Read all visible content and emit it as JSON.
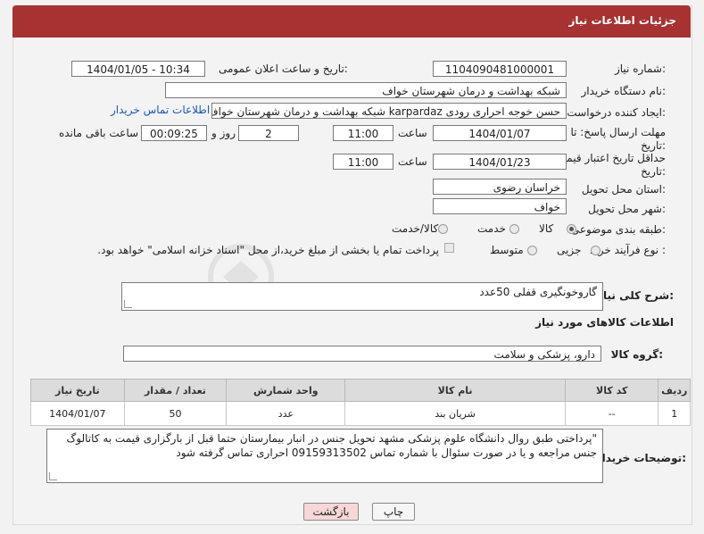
{
  "header": {
    "title": "جزئیات اطلاعات نیاز"
  },
  "form": {
    "need_number_label": "شماره نیاز:",
    "need_number": "1104090481000001",
    "announce_label": "تاریخ و ساعت اعلان عمومی:",
    "announce_value": "1404/01/05 - 10:34",
    "buyer_org_label": "نام دستگاه خریدار:",
    "buyer_org": "شبکه بهداشت و درمان شهرستان خواف",
    "creator_label": "ایجاد کننده درخواست:",
    "creator": "حسن خوجه احراری رودی karpardaz شبکه بهداشت و درمان شهرستان خواف",
    "contact_link": "اطلاعات تماس خریدار",
    "reply_deadline_label": "مهلت ارسال پاسخ: تا",
    "reply_deadline_label2": "تاریخ:",
    "reply_date": "1404/01/07",
    "time_label": "ساعت",
    "reply_time": "11:00",
    "days_value": "2",
    "days_label": "روز و",
    "remaining_time": "00:09:25",
    "remaining_label": "ساعت باقی مانده",
    "validity_label": "حداقل تاریخ اعتبار قیمت: تا",
    "validity_label2": "تاریخ:",
    "validity_date": "1404/01/23",
    "validity_time": "11:00",
    "province_label": "استان محل تحویل:",
    "province": "خراسان رضوی",
    "city_label": "شهر محل تحویل:",
    "city": "خواف",
    "category_label": "طبقه بندی موضوعی:",
    "category_options": [
      "کالا",
      "خدمت",
      "کالا/خدمت"
    ],
    "category_selected": "کالا",
    "purchase_type_label": "نوع فرآیند خرید :",
    "purchase_options": [
      "جزیی",
      "متوسط"
    ],
    "purchase_note": "پرداخت تمام یا بخشی از مبلغ خرید،از محل \"اسناد خزانه اسلامی\" خواهد بود."
  },
  "summary": {
    "label": "شرح کلی نیاز:",
    "value": "گاروخونگیری قفلی 50عدد"
  },
  "goods": {
    "section_title": "اطلاعات کالاهای مورد نیاز",
    "group_label": "گروه کالا:",
    "group_value": "دارو، پزشکی و سلامت",
    "columns": [
      "ردیف",
      "کد کالا",
      "نام کالا",
      "واحد شمارش",
      "تعداد / مقدار",
      "تاریخ نیاز"
    ],
    "rows": [
      [
        "1",
        "--",
        "شریان بند",
        "عدد",
        "50",
        "1404/01/07"
      ]
    ]
  },
  "buyer_notes": {
    "label": "توضیحات خریدار:",
    "line1": "\"پرداختی طبق روال دانشگاه علوم پزشکی مشهد تحویل جنس در انبار بیمارستان  حتما قبل از بارگزاری قیمت به کاتالوگ",
    "line2": "جنس مراجعه و یا در صورت سئوال با  شماره تماس 09159313502 احراری تماس گرفته شود"
  },
  "buttons": {
    "print": "چاپ",
    "back": "بازگشت"
  },
  "watermark": {
    "text": "AriaTender.net"
  },
  "colors": {
    "header": "#a63232",
    "link": "#1c57b8",
    "back_button": "#f7d7d7"
  }
}
